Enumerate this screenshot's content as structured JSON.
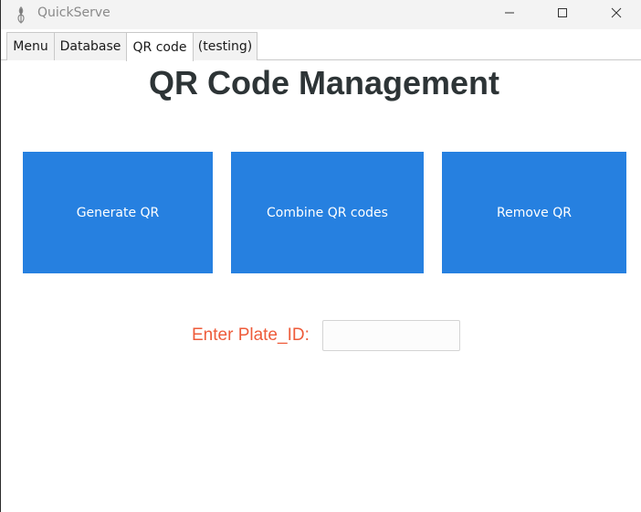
{
  "window": {
    "title": "QuickServe",
    "app_icon": "leaf-logo-icon",
    "controls": [
      "minimize-icon",
      "maximize-icon",
      "close-icon"
    ]
  },
  "tabs": [
    {
      "label": "Menu",
      "active": false
    },
    {
      "label": "Database",
      "active": false
    },
    {
      "label": "QR code",
      "active": true
    },
    {
      "label": "(testing)",
      "active": false
    }
  ],
  "main": {
    "title": "QR Code Management",
    "buttons": {
      "generate": "Generate QR",
      "combine": "Combine QR codes",
      "remove": "Remove QR"
    },
    "plate_label": "Enter Plate_ID:",
    "plate_input_value": ""
  },
  "colors": {
    "button_bg": "#2680e0",
    "button_text": "#ffffff",
    "label_color": "#ee5b3a",
    "title_color": "#2d3436"
  }
}
